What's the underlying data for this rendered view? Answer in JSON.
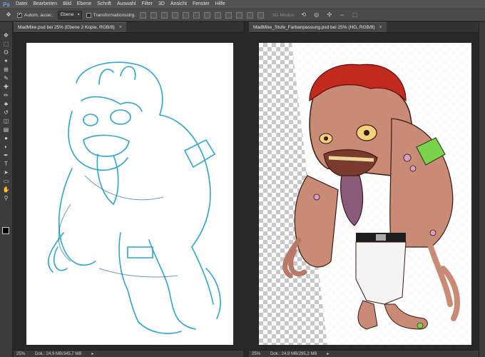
{
  "app": {
    "logo": "Ps"
  },
  "menu": [
    "Datei",
    "Bearbeiten",
    "Bild",
    "Ebene",
    "Schrift",
    "Auswahl",
    "Filter",
    "3D",
    "Ansicht",
    "Fenster",
    "Hilfe"
  ],
  "options": {
    "auto_select_label": "Autom. ausw.:",
    "auto_select_value": "Ebene",
    "transform_label": "Transformationsstrg.",
    "mode_3d_label": "3D-Modus:"
  },
  "colors": {
    "accent": "#5fa8e8",
    "ui_bg": "#535353",
    "panel": "#3b3b3b"
  },
  "left_doc": {
    "tab_title": "MadMike.psd bei 25% (Ebene 2 Kopie, RGB/8)",
    "zoom": "25%",
    "doc_info": "Dok.: 24,9 MB/345,7 MB"
  },
  "right_doc": {
    "tab_title": "MadMike_Stufe_Farbanpassung.psd bei 25% (HG, RGB/8)",
    "zoom": "25%",
    "doc_info": "Dok.: 24,9 MB/295,2 MB"
  },
  "tools": [
    "move-icon",
    "marquee-icon",
    "lasso-icon",
    "magic-wand-icon",
    "crop-icon",
    "eyedropper-icon",
    "healing-icon",
    "brush-icon",
    "stamp-icon",
    "history-brush-icon",
    "eraser-icon",
    "gradient-icon",
    "blur-icon",
    "dodge-icon",
    "pen-icon",
    "type-icon",
    "path-select-icon",
    "shape-icon",
    "hand-icon",
    "zoom-icon"
  ],
  "tool_glyphs": [
    "✥",
    "⬚",
    "ʘ",
    "✦",
    "⊞",
    "✎",
    "✚",
    "✏",
    "♣",
    "↺",
    "◫",
    "▤",
    "●",
    "◐",
    "✒",
    "T",
    "➤",
    "▭",
    "✋",
    "⚲"
  ]
}
